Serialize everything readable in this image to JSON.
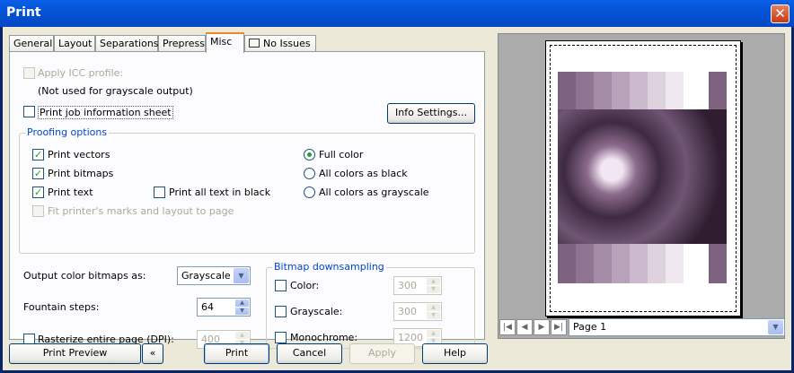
{
  "window": {
    "title": "Print",
    "close_symbol": "✕"
  },
  "tabs": [
    {
      "label": "General"
    },
    {
      "label": "Layout"
    },
    {
      "label": "Separations"
    },
    {
      "label": "Prepress"
    },
    {
      "label": "Misc",
      "active": true
    },
    {
      "label": "No Issues"
    }
  ],
  "misc": {
    "apply_icc_label": "Apply ICC profile:",
    "icc_note": "(Not used for grayscale output)",
    "print_job_info_label": "Print job information sheet",
    "info_settings_button": "Info Settings...",
    "proofing": {
      "title": "Proofing options",
      "print_vectors": "Print vectors",
      "print_bitmaps": "Print bitmaps",
      "print_text": "Print text",
      "print_all_text_black": "Print all text in black",
      "fit_printers_marks": "Fit printer's marks and layout to page",
      "full_color": "Full color",
      "all_black": "All colors as black",
      "all_grayscale": "All colors as grayscale"
    },
    "output_color_label": "Output color bitmaps as:",
    "output_color_value": "Grayscale",
    "fountain_steps_label": "Fountain steps:",
    "fountain_steps_value": "64",
    "rasterize_label": "Rasterize entire page (DPI):",
    "rasterize_value": "400",
    "downsampling": {
      "title": "Bitmap downsampling",
      "color_label": "Color:",
      "color_value": "300",
      "grayscale_label": "Grayscale:",
      "grayscale_value": "300",
      "mono_label": "Monochrome:",
      "mono_value": "1200"
    }
  },
  "preview": {
    "page_select_value": "Page 1"
  },
  "footer": {
    "print_preview": "Print Preview",
    "collapse_symbol": "«",
    "print": "Print",
    "cancel": "Cancel",
    "apply": "Apply",
    "help": "Help"
  },
  "colors": {
    "accent": "#0046d5",
    "check": "#21a121",
    "title_bar": "#0553d6"
  }
}
